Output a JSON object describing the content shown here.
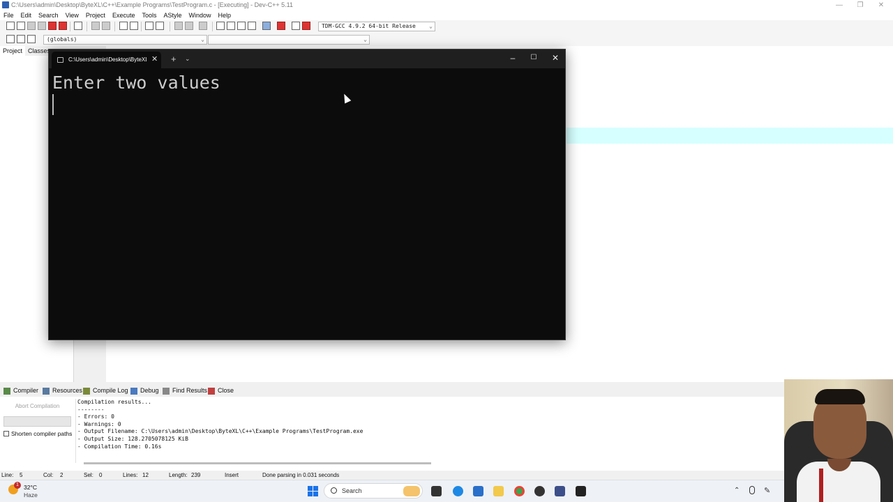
{
  "devcpp": {
    "title": "C:\\Users\\admin\\Desktop\\ByteXL\\C++\\Example Programs\\TestProgram.c - [Executing] - Dev-C++ 5.11",
    "menu": [
      "File",
      "Edit",
      "Search",
      "View",
      "Project",
      "Execute",
      "Tools",
      "AStyle",
      "Window",
      "Help"
    ],
    "compiler_select": "TDM-GCC 4.9.2 64-bit Release",
    "scope_select": "(globals)",
    "scope_select2": "",
    "left_tabs": [
      "Project",
      "Classes"
    ],
    "bottom_tabs": [
      "Compiler",
      "Resources",
      "Compile Log",
      "Debug",
      "Find Results",
      "Close"
    ],
    "abort_button": "Abort Compilation",
    "shorten_label": "Shorten compiler paths",
    "log_lines": [
      "Compilation results...",
      "--------",
      "- Errors: 0",
      "- Warnings: 0",
      "- Output Filename: C:\\Users\\admin\\Desktop\\ByteXL\\C++\\Example Programs\\TestProgram.exe",
      "- Output Size: 128.2705078125 KiB",
      "- Compilation Time: 0.16s"
    ],
    "status": {
      "line_label": "Line:",
      "line_value": "5",
      "col_label": "Col:",
      "col_value": "2",
      "sel_label": "Sel:",
      "sel_value": "0",
      "lines_label": "Lines:",
      "lines_value": "12",
      "length_label": "Length:",
      "length_value": "239",
      "mode": "Insert",
      "message": "Done parsing in 0.031 seconds"
    }
  },
  "console": {
    "tab_title": "C:\\Users\\admin\\Desktop\\ByteXL",
    "output": "Enter two values"
  },
  "taskbar": {
    "temperature": "32°C",
    "weather": "Haze",
    "weather_badge": "1",
    "search_label": "Search"
  },
  "colors": {
    "editor_highlight": "#d6ffff",
    "console_bg": "#0c0c0c",
    "console_text": "#cccccc"
  }
}
